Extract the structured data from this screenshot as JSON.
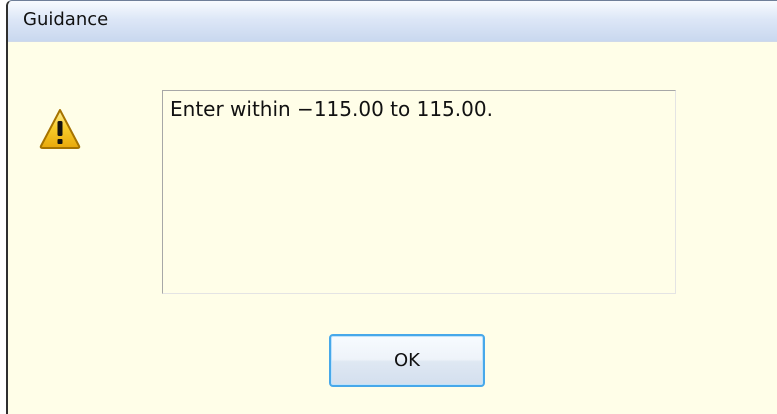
{
  "window": {
    "title": "Guidance"
  },
  "message": {
    "text": "Enter within −115.00 to 115.00."
  },
  "buttons": {
    "ok_label": "OK"
  },
  "icons": {
    "warning": "warning-icon"
  },
  "colors": {
    "background": "#fffee8",
    "titlebar": "#dde7f7",
    "button_border": "#47a8ea",
    "warning_fill": "#f6c21d"
  }
}
